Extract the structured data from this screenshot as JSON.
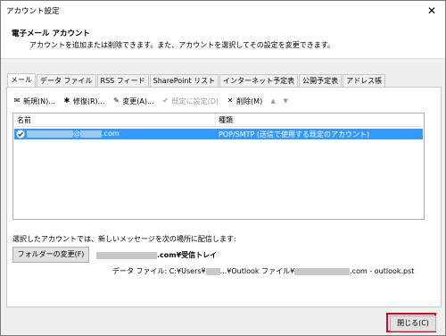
{
  "window": {
    "title": "アカウント設定"
  },
  "header": {
    "title": "電子メール アカウント",
    "description": "アカウントを追加または削除できます。また、アカウントを選択してその設定を変更できます。"
  },
  "tabs": [
    {
      "label": "メール"
    },
    {
      "label": "データ ファイル"
    },
    {
      "label": "RSS フィード"
    },
    {
      "label": "SharePoint リスト"
    },
    {
      "label": "インターネット予定表"
    },
    {
      "label": "公開予定表"
    },
    {
      "label": "アドレス帳"
    }
  ],
  "toolbar": {
    "new": "新規(N)...",
    "repair": "修復(R)...",
    "change": "変更(A)...",
    "set_default": "既定に設定(D)",
    "remove": "削除(M)"
  },
  "list": {
    "col_name": "名前",
    "col_type": "種類",
    "rows": [
      {
        "name_suffix": "@",
        "name_domain": ".com",
        "type": "POP/SMTP (送信で使用する既定のアカウント)"
      }
    ]
  },
  "delivery": {
    "message": "選択したアカウントでは、新しいメッセージを次の場所に配信します:",
    "change_folder": "フォルダーの変更(F)",
    "folder_path_suffix": ".com¥受信トレイ",
    "data_file_label": "データ ファイル: C:¥Users¥",
    "data_file_mid": "...¥Outlook ファイル¥",
    "data_file_end": ".com - outlook.pst"
  },
  "footer": {
    "close": "閉じる(C)"
  },
  "colors": {
    "selection": "#3399ff",
    "highlight": "#e0001a"
  }
}
